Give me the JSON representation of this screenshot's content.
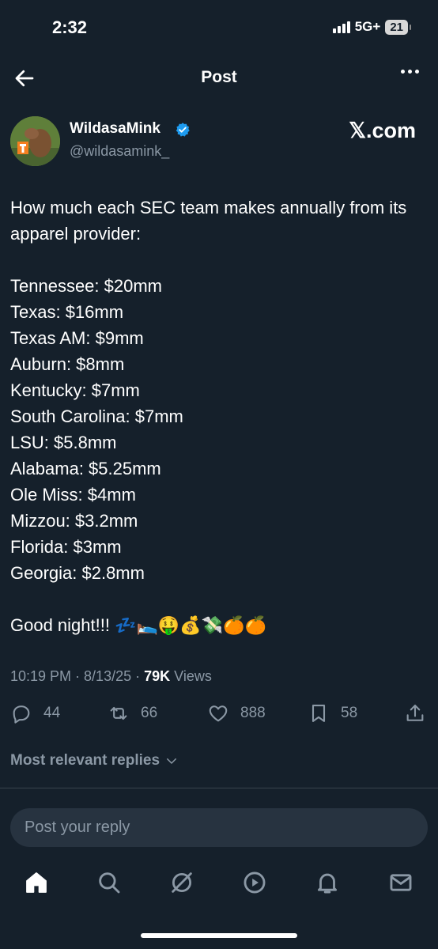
{
  "status_bar": {
    "time": "2:32",
    "network": "5G+",
    "battery": "21"
  },
  "header": {
    "title": "Post"
  },
  "author": {
    "display_name": "WildasaMink",
    "handle": "@wildasamink_",
    "source": "𝕏.com"
  },
  "tweet": {
    "intro": "How much each SEC team makes annually from its apparel provider:",
    "items": [
      "Tennessee: $20mm",
      "Texas: $16mm",
      "Texas AM: $9mm",
      "Auburn: $8mm",
      "Kentucky: $7mm",
      "South Carolina: $7mm",
      "LSU: $5.8mm",
      "Alabama: $5.25mm",
      "Ole Miss: $4mm",
      "Mizzou: $3.2mm",
      "Florida: $3mm",
      "Georgia: $2.8mm"
    ],
    "closing": "Good night!!! 💤🛌🤑💰💸🍊🍊"
  },
  "meta": {
    "time": "10:19 PM",
    "date": "8/13/25",
    "views_count": "79K",
    "views_label": "Views"
  },
  "actions": {
    "replies": "44",
    "reposts": "66",
    "likes": "888",
    "bookmarks": "58"
  },
  "replies_section": {
    "label": "Most relevant replies"
  },
  "reply_box": {
    "placeholder": "Post your reply"
  },
  "colors": {
    "background": "#15202b",
    "secondary_text": "#8b98a5",
    "verified": "#1d9bf0",
    "input_bg": "#273340"
  }
}
